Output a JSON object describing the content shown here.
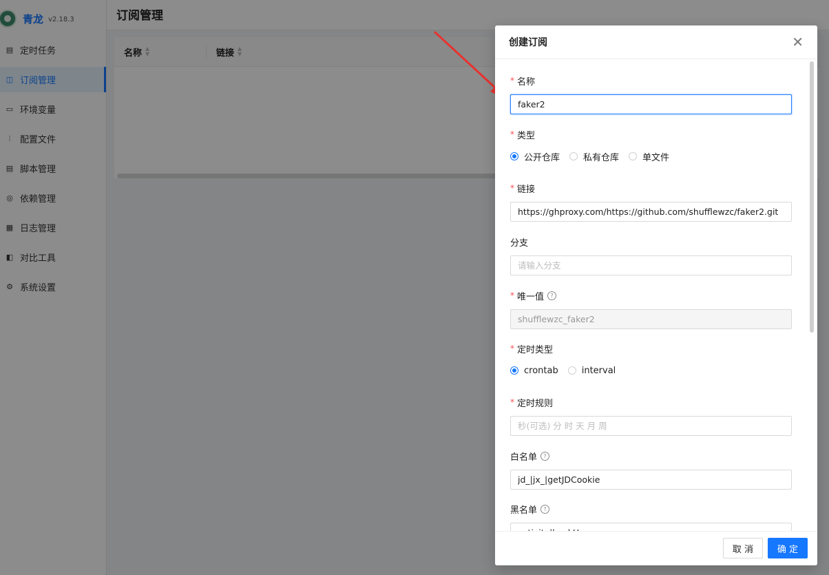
{
  "app": {
    "name": "青龙",
    "version": "v2.18.3"
  },
  "sidebar": {
    "items": [
      {
        "label": "定时任务",
        "icon": "schedule-icon"
      },
      {
        "label": "订阅管理",
        "icon": "subscription-icon",
        "active": true
      },
      {
        "label": "环境变量",
        "icon": "env-icon"
      },
      {
        "label": "配置文件",
        "icon": "config-icon"
      },
      {
        "label": "脚本管理",
        "icon": "script-icon"
      },
      {
        "label": "依赖管理",
        "icon": "dependency-icon"
      },
      {
        "label": "日志管理",
        "icon": "log-icon"
      },
      {
        "label": "对比工具",
        "icon": "diff-icon"
      },
      {
        "label": "系统设置",
        "icon": "settings-icon"
      }
    ]
  },
  "page": {
    "title": "订阅管理"
  },
  "table": {
    "columns": [
      "名称",
      "链接"
    ]
  },
  "modal": {
    "title": "创建订阅",
    "fields": {
      "name": {
        "label": "名称",
        "value": "faker2",
        "required": true
      },
      "type": {
        "label": "类型",
        "required": true,
        "options": [
          "公开仓库",
          "私有仓库",
          "单文件"
        ],
        "selected": "公开仓库"
      },
      "link": {
        "label": "链接",
        "value": "https://ghproxy.com/https://github.com/shufflewzc/faker2.git",
        "required": true
      },
      "branch": {
        "label": "分支",
        "placeholder": "请输入分支",
        "required": false
      },
      "alias": {
        "label": "唯一值",
        "value": "shufflewzc_faker2",
        "required": true,
        "disabled": true
      },
      "schedule_type": {
        "label": "定时类型",
        "required": true,
        "options": [
          "crontab",
          "interval"
        ],
        "selected": "crontab"
      },
      "schedule": {
        "label": "定时规则",
        "placeholder": "秒(可选) 分 时 天 月 周",
        "required": true
      },
      "whitelist": {
        "label": "白名单",
        "value": "jd_|jx_|getJDCookie"
      },
      "blacklist": {
        "label": "黑名单",
        "value": "activity|backUp"
      }
    },
    "buttons": {
      "cancel": "取 消",
      "ok": "确 定"
    }
  },
  "colors": {
    "primary": "#1677ff",
    "required": "#ff4d4f",
    "annotation_arrow": "#e8322f"
  }
}
